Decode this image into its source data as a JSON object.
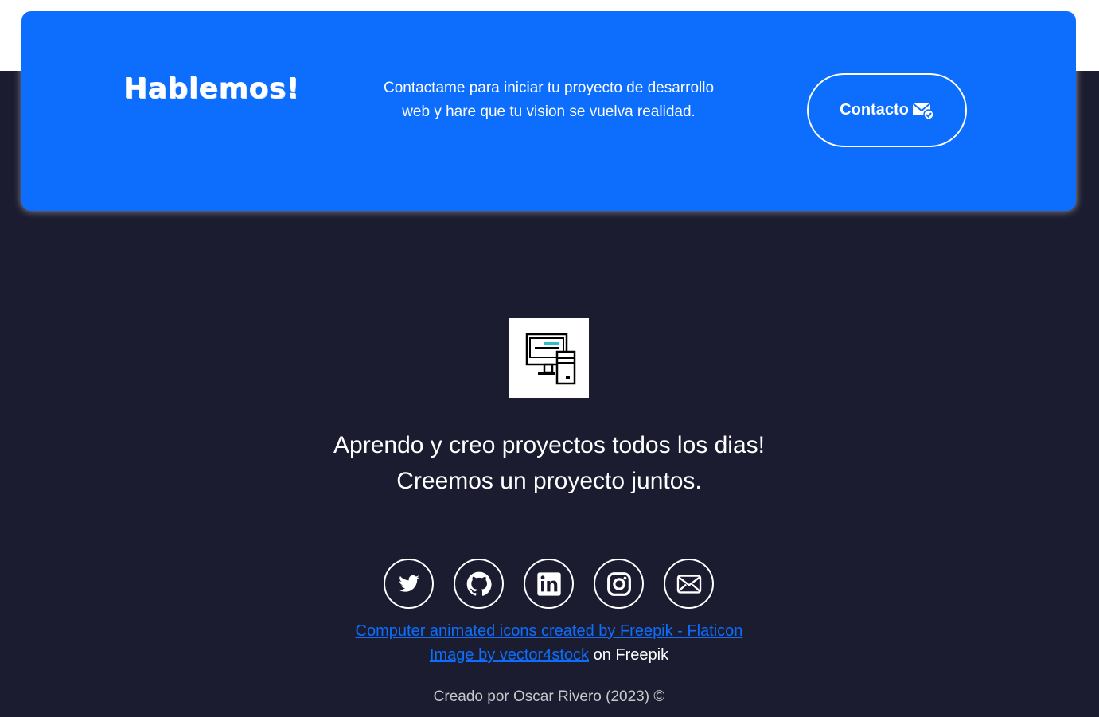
{
  "cta": {
    "title": "Hablemos!",
    "text": "Contactame para iniciar tu proyecto de desarrollo web y hare que tu vision se vuelva realidad.",
    "button_label": "Contacto",
    "button_icon": "mail-check-icon"
  },
  "logo": {
    "icon": "computer-desktop-icon"
  },
  "tagline": {
    "line1": "Aprendo y creo proyectos todos los dias!",
    "line2": "Creemos un proyecto juntos."
  },
  "socials": [
    {
      "name": "twitter",
      "icon": "twitter-icon"
    },
    {
      "name": "github",
      "icon": "github-icon"
    },
    {
      "name": "linkedin",
      "icon": "linkedin-icon"
    },
    {
      "name": "instagram",
      "icon": "instagram-icon"
    },
    {
      "name": "email",
      "icon": "envelope-icon"
    }
  ],
  "credits": {
    "flaticon_link": "Computer animated icons created by Freepik - Flaticon",
    "image_link": "Image by vector4stock",
    "image_suffix": " on Freepik"
  },
  "copyright": "Creado por Oscar Rivero (2023) ©",
  "colors": {
    "background": "#1c1c30",
    "accent": "#0d6efd",
    "white": "#ffffff"
  }
}
